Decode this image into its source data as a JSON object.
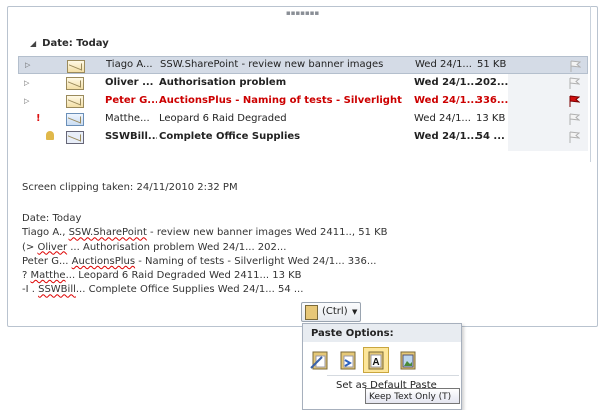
{
  "group_header": "Date: Today",
  "messages": [
    {
      "from": "Tiago A...",
      "subject": "SSW.SharePoint - review new banner images",
      "received": "Wed 24/1...",
      "size": "51 KB",
      "state": "selected"
    },
    {
      "from": "Oliver ...",
      "subject": "Authorisation problem",
      "received": "Wed 24/1...",
      "size": "202...",
      "state": "unread"
    },
    {
      "from": "Peter G...",
      "subject": "AuctionsPlus - Naming of tests - Silverlight",
      "received": "Wed 24/1...",
      "size": "336...",
      "state": "flagged"
    },
    {
      "from": "Matthe...",
      "subject": "Leopard 6 Raid Degraded",
      "received": "Wed 24/1...",
      "size": "13 KB",
      "state": "important"
    },
    {
      "from": "SSWBill...",
      "subject": "Complete Office Supplies",
      "received": "Wed 24/1...",
      "size": "54 ...",
      "state": "unread"
    }
  ],
  "clipping_text": "Screen clipping taken: 24/11/2010 2:32 PM",
  "pasted": {
    "l1": "Date: Today",
    "l2a": "Tiago A., ",
    "l2b": "SSW.SharePoint",
    "l2c": " - review new banner images Wed 2411.., 51 KB",
    "l3a": "(> ",
    "l3b": "Oliver",
    "l3c": " ... Authorisation problem Wed 24/1... 202...",
    "l4a": "Peter G... ",
    "l4b": "AuctionsPlus",
    "l4c": " - Naming of tests - Silverlight Wed 24/1... 336...",
    "l5a": "? ",
    "l5b": "Matthe",
    "l5c": "... Leopard 6 Raid Degraded Wed 2411... 13 KB",
    "l6a": "-I . ",
    "l6b": "SSWBill",
    "l6c": "... Complete Office Supplies Wed 24/1... 54 ..."
  },
  "ctrl_button": "(Ctrl)",
  "paste_options_title": "Paste Options:",
  "set_default": "Set as Default Paste",
  "tooltip": "Keep Text Only (T)",
  "icons": [
    "expand-icon",
    "importance-icon",
    "reminder-bell-icon",
    "envelope-icon",
    "flag-icon",
    "clipboard-icon",
    "keep-source-formatting-icon",
    "merge-formatting-icon",
    "keep-text-only-icon",
    "picture-icon"
  ]
}
